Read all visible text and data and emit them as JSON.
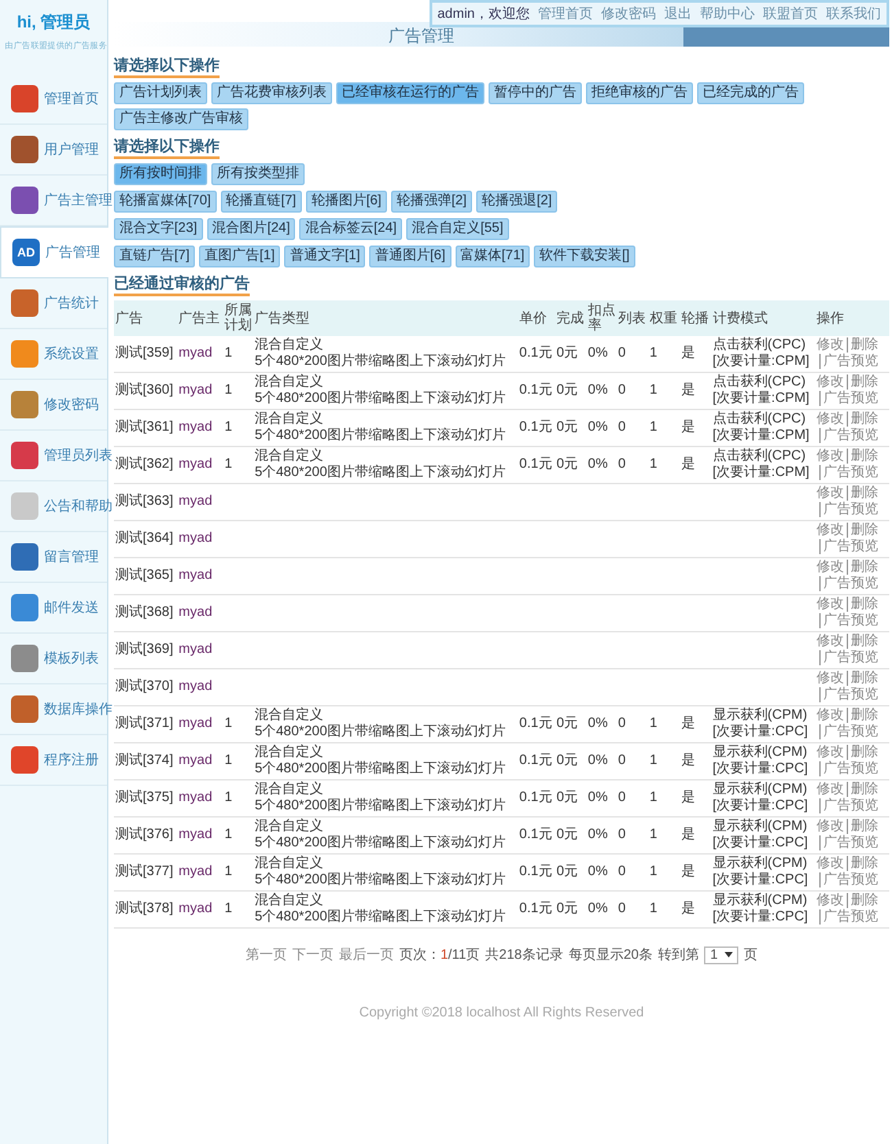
{
  "logo": {
    "title": "hi, 管理员",
    "subtitle": "由广告联盟提供的广告服务"
  },
  "sidebar": {
    "items": [
      {
        "label": "管理首页",
        "color": "#d9442a",
        "selected": false
      },
      {
        "label": "用户管理",
        "color": "#a0522d",
        "selected": false
      },
      {
        "label": "广告主管理",
        "color": "#7b4fb0",
        "selected": false
      },
      {
        "label": "广告管理",
        "color": "#1f6fc4",
        "selected": true,
        "icon_text": "AD"
      },
      {
        "label": "广告统计",
        "color": "#c8632a",
        "selected": false
      },
      {
        "label": "系统设置",
        "color": "#f08a1c",
        "selected": false
      },
      {
        "label": "修改密码",
        "color": "#b7823a",
        "selected": false
      },
      {
        "label": "管理员列表",
        "color": "#d63a4a",
        "selected": false
      },
      {
        "label": "公告和帮助",
        "color": "#c9c9c9",
        "selected": false
      },
      {
        "label": "留言管理",
        "color": "#2f6db5",
        "selected": false
      },
      {
        "label": "邮件发送",
        "color": "#3a8ad6",
        "selected": false
      },
      {
        "label": "模板列表",
        "color": "#8c8c8c",
        "selected": false
      },
      {
        "label": "数据库操作",
        "color": "#c0602a",
        "selected": false
      },
      {
        "label": "程序注册",
        "color": "#e0452a",
        "selected": false
      }
    ]
  },
  "top_links": [
    "admin，欢迎您",
    "管理首页",
    "修改密码",
    "退出",
    "帮助中心",
    "联盟首页",
    "联系我们"
  ],
  "page_title": "广告管理",
  "sections": [
    {
      "heading": "请选择以下操作",
      "button_rows": [
        [
          {
            "label": "广告计划列表",
            "selected": false
          },
          {
            "label": "广告花费审核列表",
            "selected": false
          },
          {
            "label": "已经审核在运行的广告",
            "selected": true
          },
          {
            "label": "暂停中的广告",
            "selected": false
          },
          {
            "label": "拒绝审核的广告",
            "selected": false
          },
          {
            "label": "已经完成的广告",
            "selected": false
          },
          {
            "label": "广告主修改广告审核",
            "selected": false
          }
        ]
      ]
    },
    {
      "heading": "请选择以下操作",
      "button_rows": [
        [
          {
            "label": "所有按时间排",
            "selected": true
          },
          {
            "label": "所有按类型排",
            "selected": false
          }
        ],
        [
          {
            "label": "轮播富媒体[70]",
            "selected": false
          },
          {
            "label": "轮播直链[7]",
            "selected": false
          },
          {
            "label": "轮播图片[6]",
            "selected": false
          },
          {
            "label": "轮播强弹[2]",
            "selected": false
          },
          {
            "label": "轮播强退[2]",
            "selected": false
          }
        ],
        [
          {
            "label": "混合文字[23]",
            "selected": false
          },
          {
            "label": "混合图片[24]",
            "selected": false
          },
          {
            "label": "混合标签云[24]",
            "selected": false
          },
          {
            "label": "混合自定义[55]",
            "selected": false
          }
        ],
        [
          {
            "label": "直链广告[7]",
            "selected": false
          },
          {
            "label": "直图广告[1]",
            "selected": false
          },
          {
            "label": "普通文字[1]",
            "selected": false
          },
          {
            "label": "普通图片[6]",
            "selected": false
          },
          {
            "label": "富媒体[71]",
            "selected": false
          },
          {
            "label": "软件下载安装[]",
            "selected": false
          }
        ]
      ]
    }
  ],
  "table": {
    "heading": "已经通过审核的广告",
    "columns": [
      "广告",
      "广告主",
      "所属计划",
      "广告类型",
      "单价",
      "完成",
      "扣点率",
      "列表",
      "权重",
      "轮播",
      "计费模式",
      "操作"
    ],
    "rows": [
      {
        "ad": "测试[359]",
        "owner": "myad",
        "plan": "1",
        "type": "混合自定义",
        "type_detail": "5个480*200图片带缩略图上下滚动幻灯片",
        "price": "0.1元",
        "done": "0元",
        "rate": "0%",
        "list": "0",
        "weight": "1",
        "carousel": "是",
        "billing": "点击获利(CPC)",
        "billing_secondary": "[次要计量:CPM]",
        "actions": [
          "修改",
          "删除",
          "广告预览"
        ]
      },
      {
        "ad": "测试[360]",
        "owner": "myad",
        "plan": "1",
        "type": "混合自定义",
        "type_detail": "5个480*200图片带缩略图上下滚动幻灯片",
        "price": "0.1元",
        "done": "0元",
        "rate": "0%",
        "list": "0",
        "weight": "1",
        "carousel": "是",
        "billing": "点击获利(CPC)",
        "billing_secondary": "[次要计量:CPM]",
        "actions": [
          "修改",
          "删除",
          "广告预览"
        ]
      },
      {
        "ad": "测试[361]",
        "owner": "myad",
        "plan": "1",
        "type": "混合自定义",
        "type_detail": "5个480*200图片带缩略图上下滚动幻灯片",
        "price": "0.1元",
        "done": "0元",
        "rate": "0%",
        "list": "0",
        "weight": "1",
        "carousel": "是",
        "billing": "点击获利(CPC)",
        "billing_secondary": "[次要计量:CPM]",
        "actions": [
          "修改",
          "删除",
          "广告预览"
        ]
      },
      {
        "ad": "测试[362]",
        "owner": "myad",
        "plan": "1",
        "type": "混合自定义",
        "type_detail": "5个480*200图片带缩略图上下滚动幻灯片",
        "price": "0.1元",
        "done": "0元",
        "rate": "0%",
        "list": "0",
        "weight": "1",
        "carousel": "是",
        "billing": "点击获利(CPC)",
        "billing_secondary": "[次要计量:CPM]",
        "actions": [
          "修改",
          "删除",
          "广告预览"
        ]
      },
      {
        "ad": "测试[363]",
        "owner": "myad",
        "actions": [
          "修改",
          "删除",
          "广告预览"
        ]
      },
      {
        "ad": "测试[364]",
        "owner": "myad",
        "actions": [
          "修改",
          "删除",
          "广告预览"
        ]
      },
      {
        "ad": "测试[365]",
        "owner": "myad",
        "actions": [
          "修改",
          "删除",
          "广告预览"
        ]
      },
      {
        "ad": "测试[368]",
        "owner": "myad",
        "actions": [
          "修改",
          "删除",
          "广告预览"
        ]
      },
      {
        "ad": "测试[369]",
        "owner": "myad",
        "actions": [
          "修改",
          "删除",
          "广告预览"
        ]
      },
      {
        "ad": "测试[370]",
        "owner": "myad",
        "actions": [
          "修改",
          "删除",
          "广告预览"
        ]
      },
      {
        "ad": "测试[371]",
        "owner": "myad",
        "plan": "1",
        "type": "混合自定义",
        "type_detail": "5个480*200图片带缩略图上下滚动幻灯片",
        "price": "0.1元",
        "done": "0元",
        "rate": "0%",
        "list": "0",
        "weight": "1",
        "carousel": "是",
        "billing": "显示获利(CPM)",
        "billing_secondary": "[次要计量:CPC]",
        "actions": [
          "修改",
          "删除",
          "广告预览"
        ]
      },
      {
        "ad": "测试[374]",
        "owner": "myad",
        "plan": "1",
        "type": "混合自定义",
        "type_detail": "5个480*200图片带缩略图上下滚动幻灯片",
        "price": "0.1元",
        "done": "0元",
        "rate": "0%",
        "list": "0",
        "weight": "1",
        "carousel": "是",
        "billing": "显示获利(CPM)",
        "billing_secondary": "[次要计量:CPC]",
        "actions": [
          "修改",
          "删除",
          "广告预览"
        ]
      },
      {
        "ad": "测试[375]",
        "owner": "myad",
        "plan": "1",
        "type": "混合自定义",
        "type_detail": "5个480*200图片带缩略图上下滚动幻灯片",
        "price": "0.1元",
        "done": "0元",
        "rate": "0%",
        "list": "0",
        "weight": "1",
        "carousel": "是",
        "billing": "显示获利(CPM)",
        "billing_secondary": "[次要计量:CPC]",
        "actions": [
          "修改",
          "删除",
          "广告预览"
        ]
      },
      {
        "ad": "测试[376]",
        "owner": "myad",
        "plan": "1",
        "type": "混合自定义",
        "type_detail": "5个480*200图片带缩略图上下滚动幻灯片",
        "price": "0.1元",
        "done": "0元",
        "rate": "0%",
        "list": "0",
        "weight": "1",
        "carousel": "是",
        "billing": "显示获利(CPM)",
        "billing_secondary": "[次要计量:CPC]",
        "actions": [
          "修改",
          "删除",
          "广告预览"
        ]
      },
      {
        "ad": "测试[377]",
        "owner": "myad",
        "plan": "1",
        "type": "混合自定义",
        "type_detail": "5个480*200图片带缩略图上下滚动幻灯片",
        "price": "0.1元",
        "done": "0元",
        "rate": "0%",
        "list": "0",
        "weight": "1",
        "carousel": "是",
        "billing": "显示获利(CPM)",
        "billing_secondary": "[次要计量:CPC]",
        "actions": [
          "修改",
          "删除",
          "广告预览"
        ]
      },
      {
        "ad": "测试[378]",
        "owner": "myad",
        "plan": "1",
        "type": "混合自定义",
        "type_detail": "5个480*200图片带缩略图上下滚动幻灯片",
        "price": "0.1元",
        "done": "0元",
        "rate": "0%",
        "list": "0",
        "weight": "1",
        "carousel": "是",
        "billing": "显示获利(CPM)",
        "billing_secondary": "[次要计量:CPC]",
        "actions": [
          "修改",
          "删除",
          "广告预览"
        ]
      }
    ]
  },
  "pagination": {
    "links": [
      "第一页",
      "下一页",
      "最后一页"
    ],
    "page_label": "页次：",
    "current": "1",
    "total": "/11页",
    "records": "共218条记录",
    "per_page": "每页显示20条",
    "goto_label": "转到第",
    "goto_value": "1",
    "goto_suffix": "页"
  },
  "footer": "Copyright ©2018 localhost All Rights Reserved"
}
